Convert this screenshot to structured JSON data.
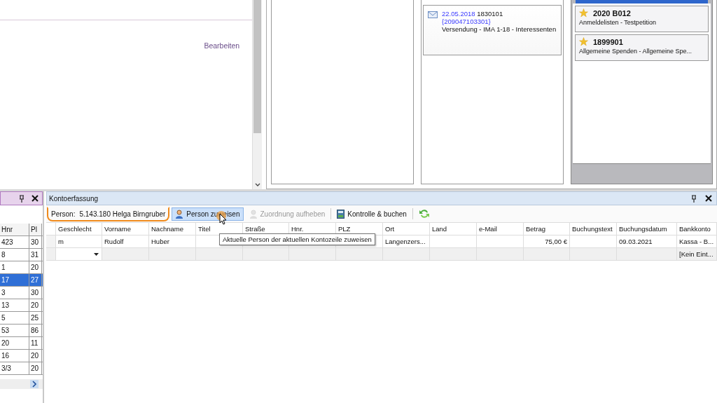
{
  "top_panel": {
    "link": "Bearbeiten"
  },
  "mail_card": {
    "date": "22.05.2018",
    "number": "1830101",
    "code": "{209047103301}",
    "text": "Versendung - IMA 1-18 - Interessenten"
  },
  "projects": [
    {
      "code": "2020 B012",
      "name": "Anmeldelisten - Testpetition"
    },
    {
      "code": "1899901",
      "name": "Allgemeine Spenden - Allgemeine Spe..."
    }
  ],
  "left_dock": {
    "columns": [
      "Hnr",
      "Pl"
    ],
    "rows": [
      {
        "cells": [
          "423",
          "30"
        ],
        "selected": false
      },
      {
        "cells": [
          "8",
          "31"
        ],
        "selected": false
      },
      {
        "cells": [
          "1",
          "20"
        ],
        "selected": false
      },
      {
        "cells": [
          "17",
          "27"
        ],
        "selected": true
      },
      {
        "cells": [
          "3",
          "30"
        ],
        "selected": false
      },
      {
        "cells": [
          "13",
          "20"
        ],
        "selected": false
      },
      {
        "cells": [
          "5",
          "25"
        ],
        "selected": false
      },
      {
        "cells": [
          "53",
          "86"
        ],
        "selected": false
      },
      {
        "cells": [
          "20",
          "11"
        ],
        "selected": false
      },
      {
        "cells": [
          "16",
          "20"
        ],
        "selected": false
      },
      {
        "cells": [
          "3/3",
          "20"
        ],
        "selected": false
      }
    ]
  },
  "kontoerfassung": {
    "title": "Kontoerfassung",
    "person_label": "Person:",
    "person_value": "5.143.180 Helga Birngruber",
    "toolbar": [
      {
        "kind": "assign",
        "label": "Person zuweisen",
        "hovered": true,
        "disabled": false
      },
      {
        "kind": "unassign",
        "label": "Zuordnung aufheben",
        "hovered": false,
        "disabled": true
      },
      {
        "kind": "book",
        "label": "Kontrolle & buchen",
        "hovered": false,
        "disabled": false
      },
      {
        "kind": "refresh",
        "hovered": false,
        "disabled": false
      }
    ],
    "columns": [
      "Geschlecht",
      "Vorname",
      "Nachname",
      "Titel",
      "Straße",
      "Hnr.",
      "PLZ",
      "Ort",
      "Land",
      "e-Mail",
      "Betrag",
      "Buchungstext",
      "Buchungsdatum",
      "Bankkonto"
    ],
    "rows": [
      {
        "kind": "data",
        "cells": [
          "m",
          "Rudolf",
          "Huber",
          "",
          "",
          "",
          "",
          "Langenzers...",
          "",
          "",
          "75,00 €",
          "",
          "09.03.2021",
          "Kassa - B..."
        ]
      },
      {
        "kind": "new",
        "cells": [
          "",
          "",
          "",
          "",
          "",
          "",
          "",
          "",
          "",
          "",
          "",
          "",
          "",
          "[Kein Eint..."
        ]
      }
    ],
    "tooltip": "Aktuelle Person der aktuellen Kontozeile zuweisen"
  }
}
